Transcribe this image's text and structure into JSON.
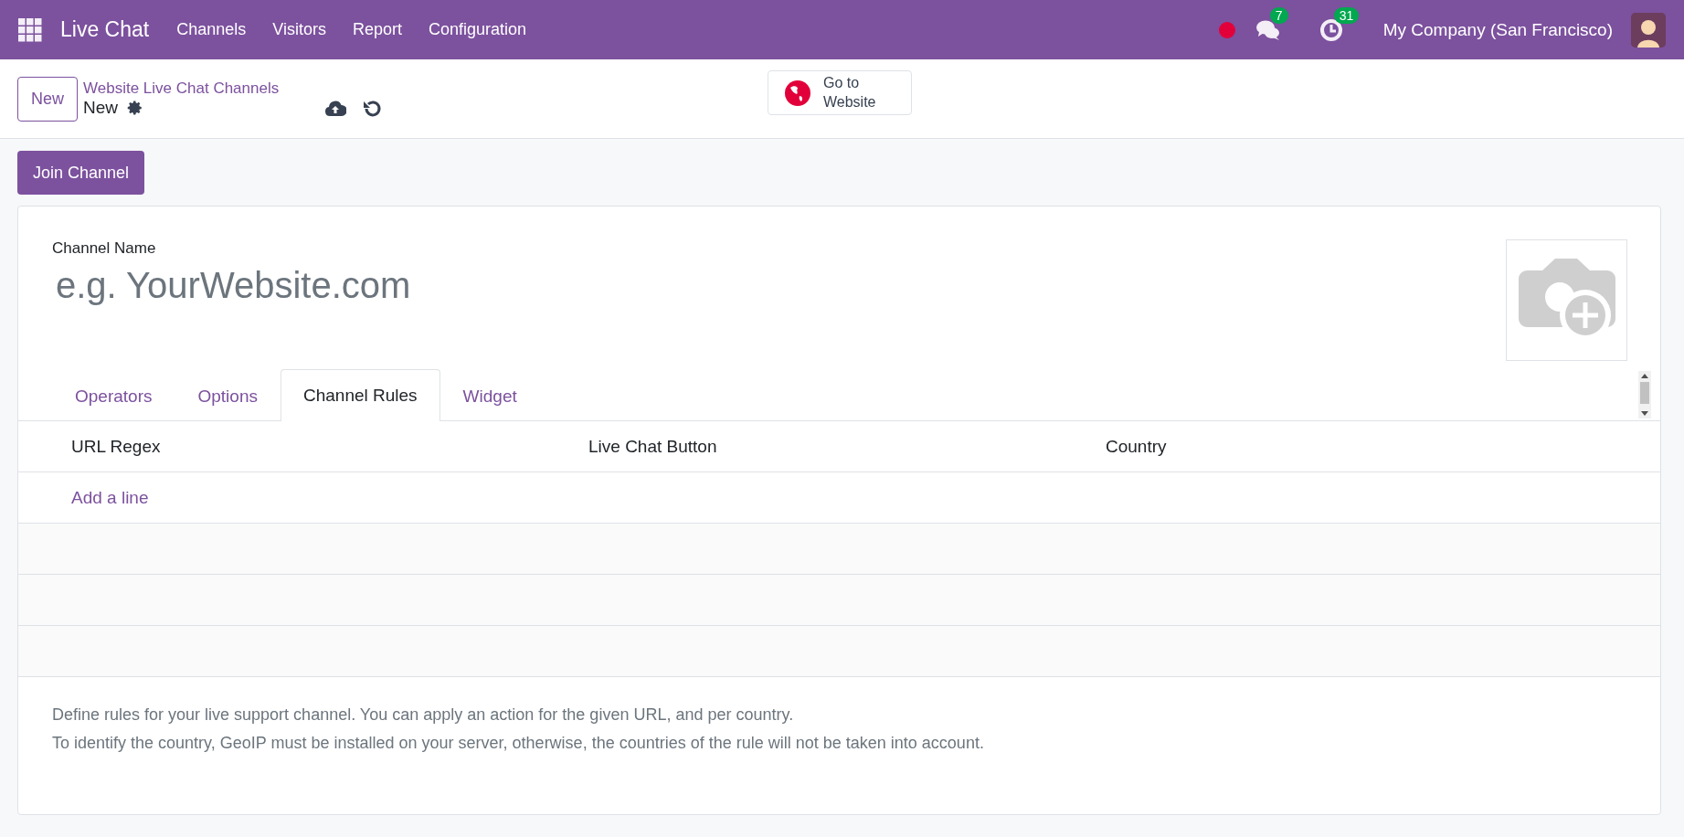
{
  "navbar": {
    "app_name": "Live Chat",
    "menu": [
      "Channels",
      "Visitors",
      "Report",
      "Configuration"
    ],
    "messages_count": "7",
    "activities_count": "31",
    "company": "My Company (San Francisco)"
  },
  "control_panel": {
    "new_button": "New",
    "breadcrumb": "Website Live Chat Channels",
    "record": "New",
    "go_to_website": "Go to Website"
  },
  "join_button": "Join Channel",
  "form": {
    "label": "Channel Name",
    "placeholder": "e.g. YourWebsite.com"
  },
  "tabs": [
    {
      "label": "Operators",
      "selected": false
    },
    {
      "label": "Options",
      "selected": false
    },
    {
      "label": "Channel Rules",
      "selected": true
    },
    {
      "label": "Widget",
      "selected": false
    }
  ],
  "table": {
    "columns": [
      "URL Regex",
      "Live Chat Button",
      "Country"
    ],
    "add_line": "Add a line"
  },
  "help_text": [
    "Define rules for your live support channel. You can apply an action for the given URL, and per country.",
    "To identify the country, GeoIP must be installed on your server, otherwise, the countries of the rule will not be taken into account."
  ]
}
